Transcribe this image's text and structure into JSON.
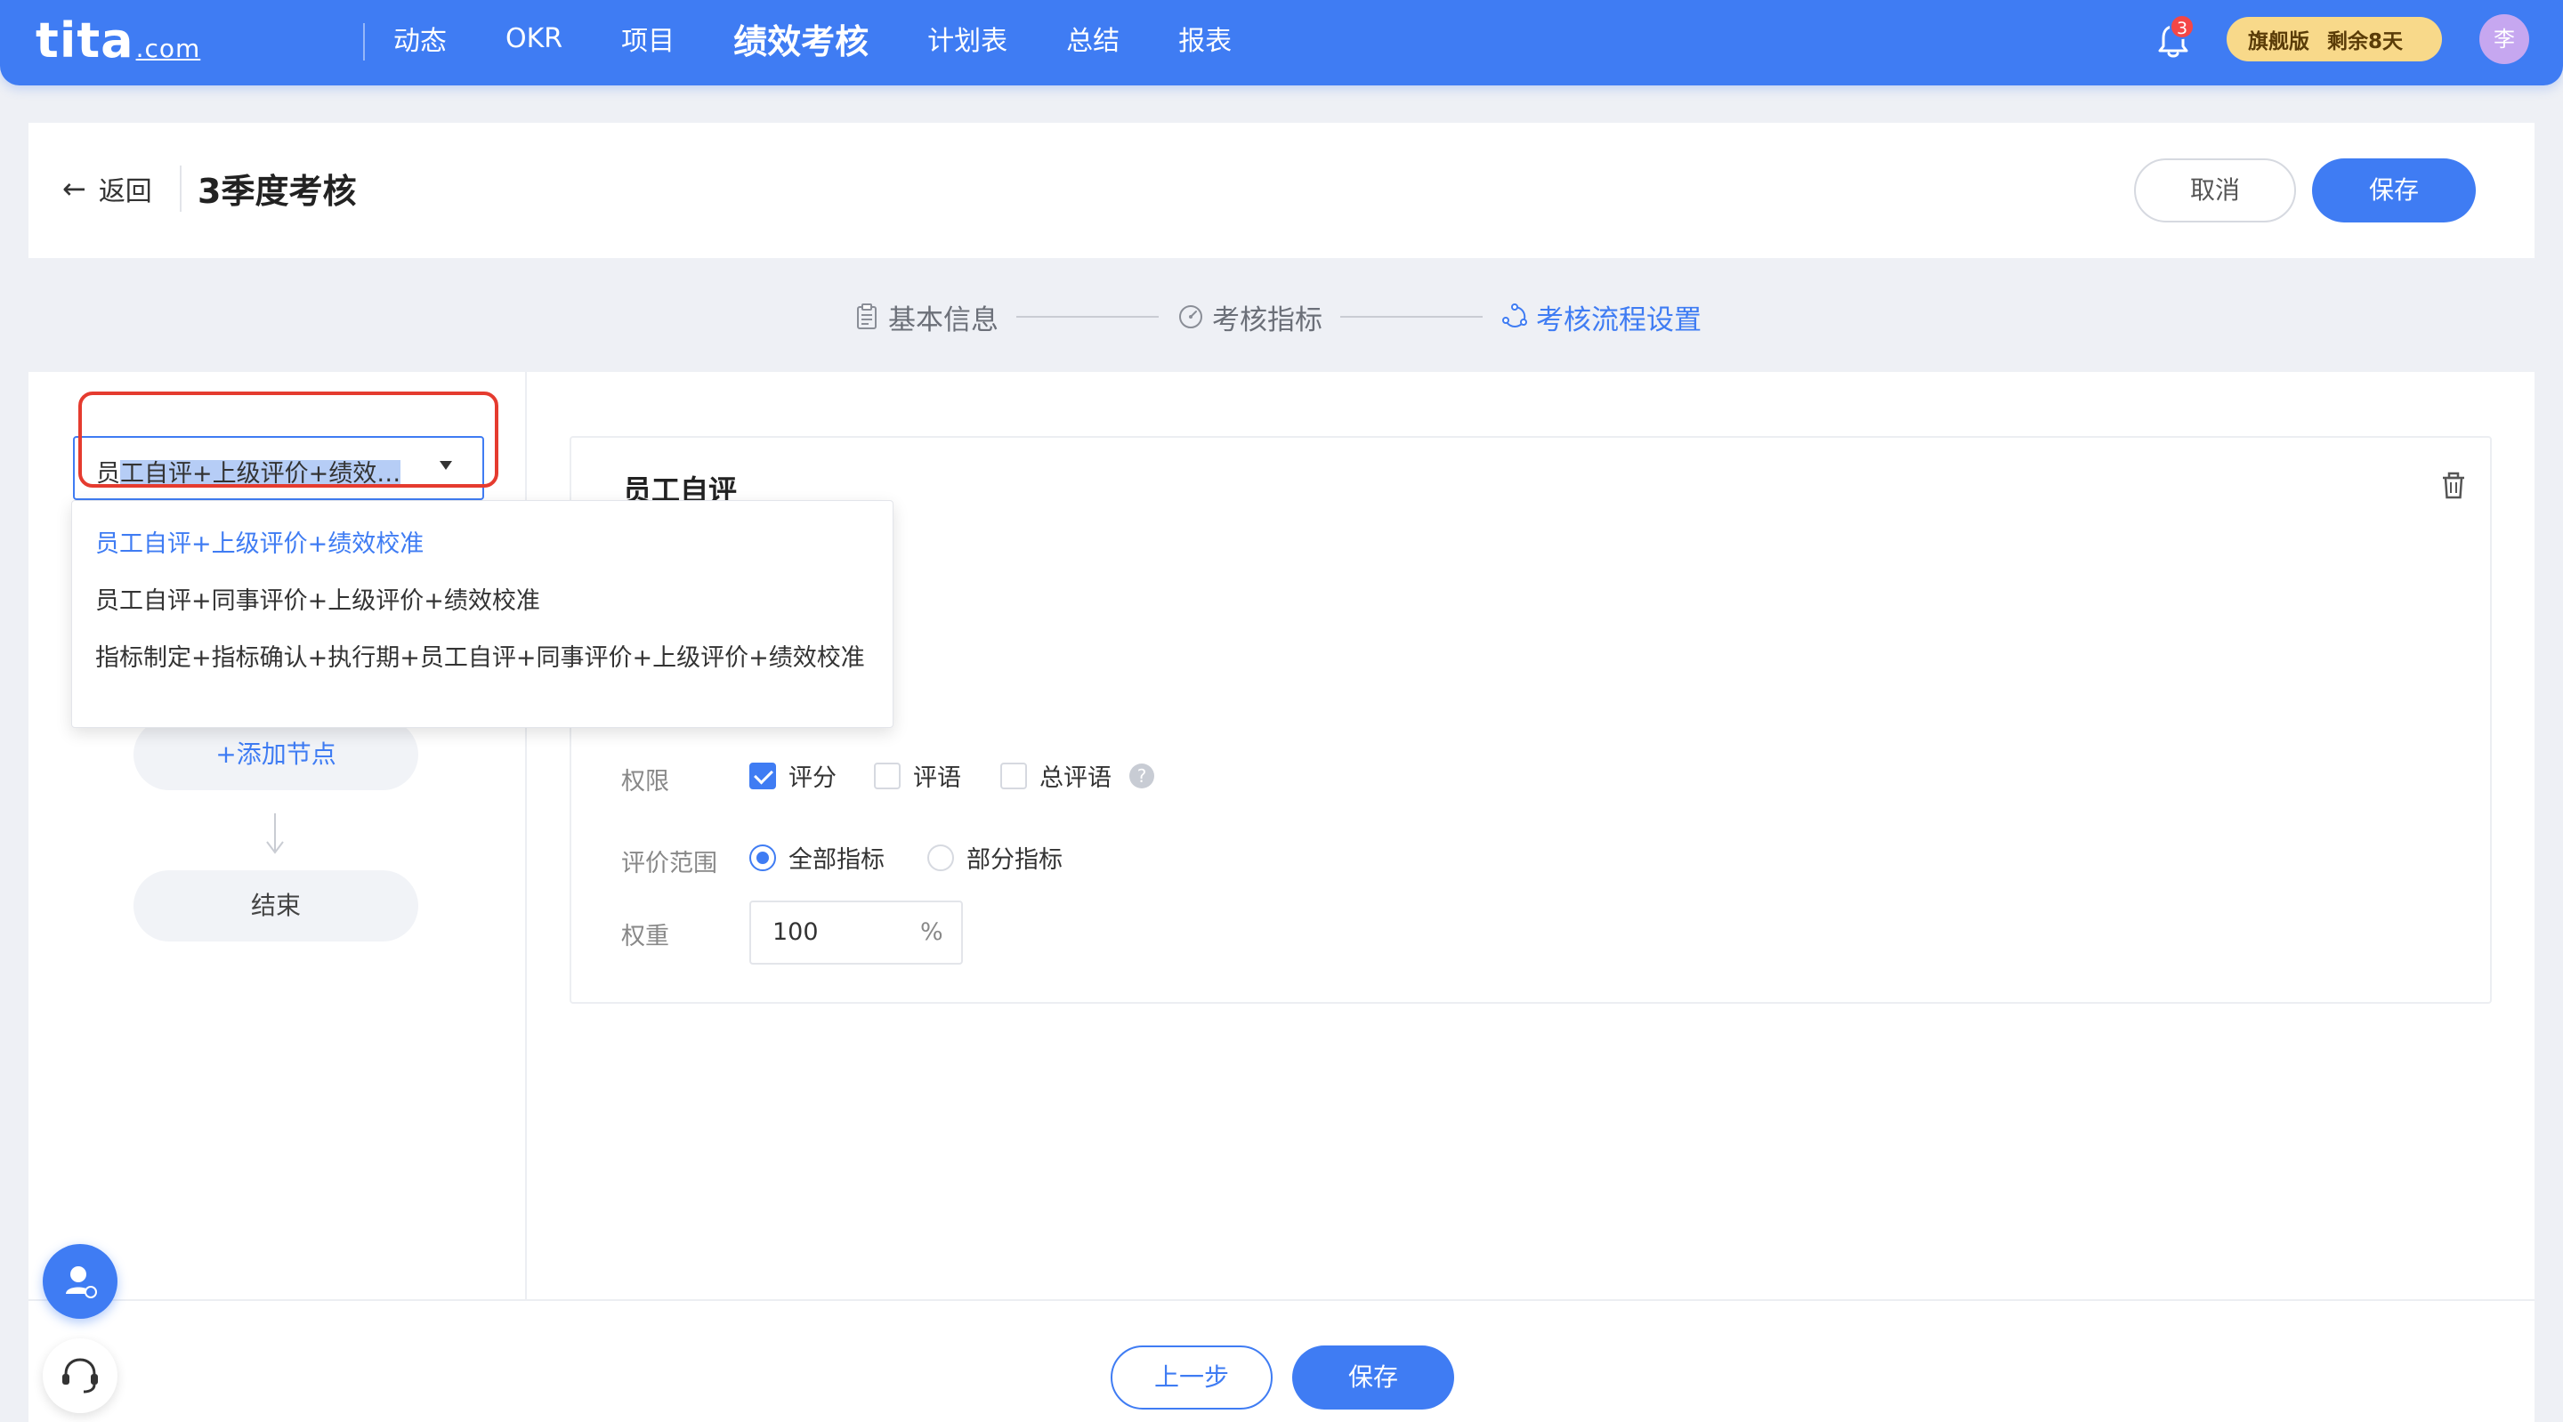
{
  "brand": {
    "logo_main": "tita",
    "logo_suffix": ".com"
  },
  "nav": {
    "items": [
      {
        "label": "动态"
      },
      {
        "label": "OKR"
      },
      {
        "label": "项目"
      },
      {
        "label": "绩效考核",
        "active": true
      },
      {
        "label": "计划表"
      },
      {
        "label": "总结"
      },
      {
        "label": "报表"
      }
    ],
    "notification_count": "3",
    "plan_label": "旗舰版",
    "plan_remaining": "剩余8天",
    "avatar_text": "李"
  },
  "header": {
    "back_label": "返回",
    "title": "3季度考核",
    "cancel_label": "取消",
    "save_label": "保存"
  },
  "steps": [
    {
      "label": "基本信息",
      "icon": "clipboard-icon"
    },
    {
      "label": "考核指标",
      "icon": "gauge-icon"
    },
    {
      "label": "考核流程设置",
      "icon": "flow-cycle-icon",
      "active": true
    }
  ],
  "flow_select": {
    "value_prefix": "员",
    "value_highlight": "工自评+上级评价+绩效…",
    "options": [
      "员工自评+上级评价+绩效校准",
      "员工自评+同事评价+上级评价+绩效校准",
      "指标制定+指标确认+执行期+员工自评+同事评价+上级评价+绩效校准"
    ],
    "selected_index": 0
  },
  "flow": {
    "add_node_label": "+添加节点",
    "end_label": "结束"
  },
  "node": {
    "title": "员工自评",
    "permission_label": "权限",
    "permissions": [
      {
        "label": "评分",
        "checked": true
      },
      {
        "label": "评语",
        "checked": false
      },
      {
        "label": "总评语",
        "checked": false
      }
    ],
    "scope_label": "评价范围",
    "scope_options": [
      {
        "label": "全部指标",
        "checked": true
      },
      {
        "label": "部分指标",
        "checked": false
      }
    ],
    "weight_label": "权重",
    "weight_value": "100",
    "weight_unit": "%"
  },
  "footer": {
    "prev_label": "上一步",
    "save_label": "保存"
  },
  "colors": {
    "primary": "#3f7cf3",
    "highlight_outline": "#e53b2f",
    "plan_gold": "#f8d98a"
  }
}
